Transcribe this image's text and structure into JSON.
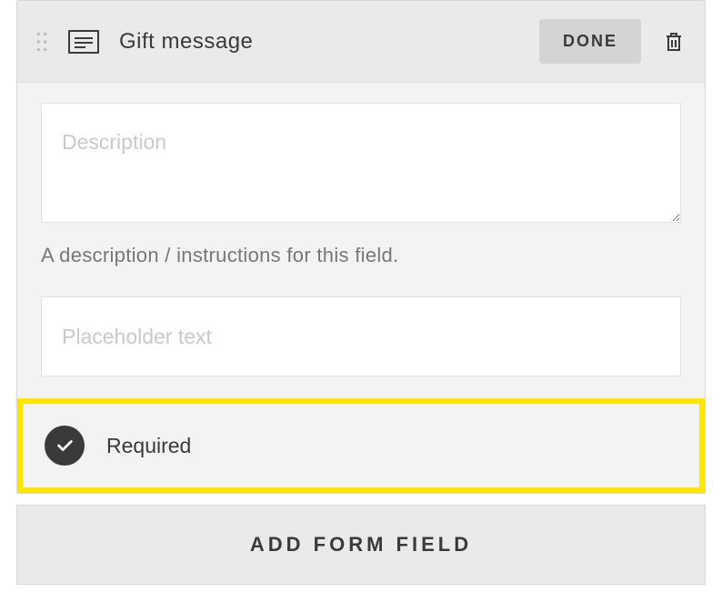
{
  "field": {
    "title": "Gift message",
    "done_label": "DONE",
    "description_placeholder": "Description",
    "description_help": "A description / instructions for this field.",
    "placeholder_placeholder": "Placeholder text",
    "required_label": "Required",
    "required_checked": true
  },
  "add_field_label": "ADD FORM FIELD"
}
